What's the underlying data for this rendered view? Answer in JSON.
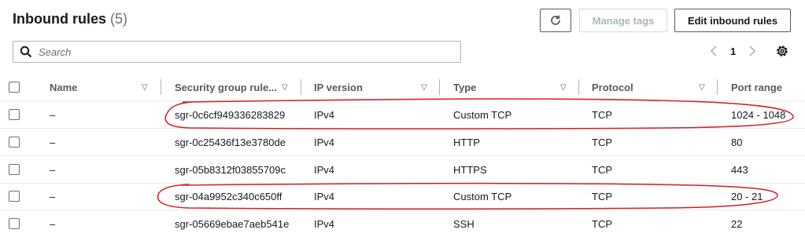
{
  "header": {
    "title": "Inbound rules",
    "count": "(5)",
    "manage_tags_label": "Manage tags",
    "edit_inbound_rules_label": "Edit inbound rules"
  },
  "search": {
    "placeholder": "Search"
  },
  "pagination": {
    "current_page": "1"
  },
  "table": {
    "columns": [
      "Name",
      "Security group rule...",
      "IP version",
      "Type",
      "Protocol",
      "Port range"
    ],
    "rows": [
      {
        "name": "–",
        "rule_id": "sgr-0c6cf949336283829",
        "ip_version": "IPv4",
        "type": "Custom TCP",
        "protocol": "TCP",
        "port_range": "1024 - 1048"
      },
      {
        "name": "–",
        "rule_id": "sgr-0c25436f13e3780de",
        "ip_version": "IPv4",
        "type": "HTTP",
        "protocol": "TCP",
        "port_range": "80"
      },
      {
        "name": "–",
        "rule_id": "sgr-05b8312f03855709c",
        "ip_version": "IPv4",
        "type": "HTTPS",
        "protocol": "TCP",
        "port_range": "443"
      },
      {
        "name": "–",
        "rule_id": "sgr-04a9952c340c650ff",
        "ip_version": "IPv4",
        "type": "Custom TCP",
        "protocol": "TCP",
        "port_range": "20 - 21"
      },
      {
        "name": "–",
        "rule_id": "sgr-05669ebae7aeb541e",
        "ip_version": "IPv4",
        "type": "SSH",
        "protocol": "TCP",
        "port_range": "22"
      }
    ]
  },
  "icons": {
    "refresh": "refresh-icon",
    "search": "search-icon",
    "prev": "chevron-left-icon",
    "next": "chevron-right-icon",
    "settings": "gear-icon",
    "sort": "sort-caret-icon"
  },
  "colors": {
    "annotation": "#d81c1c",
    "border": "#eaeded",
    "text_secondary": "#545b64",
    "disabled": "#aab7b8"
  }
}
